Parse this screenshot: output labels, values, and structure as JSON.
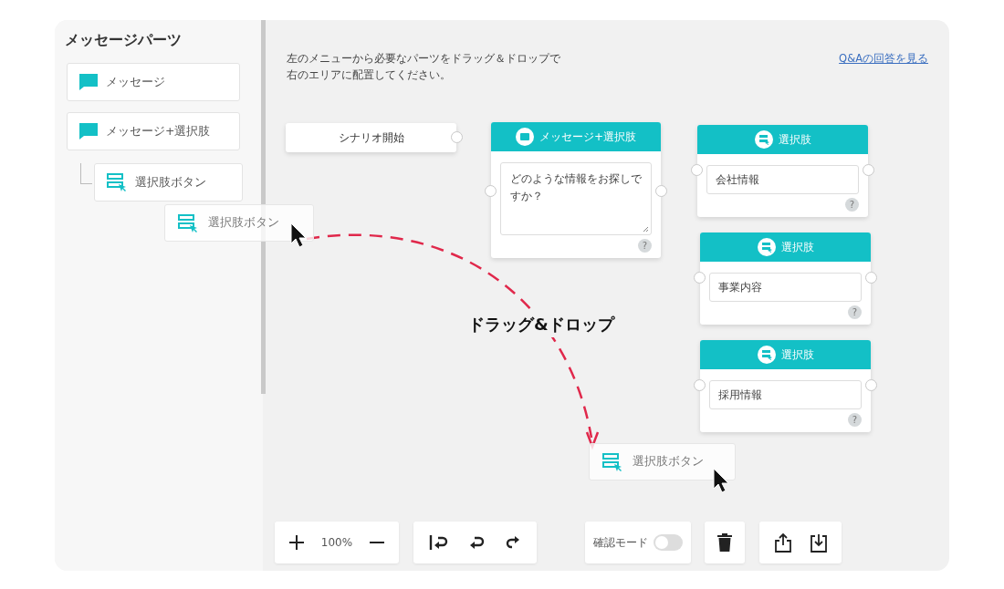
{
  "sidebar": {
    "title": "メッセージパーツ",
    "items": [
      {
        "label": "メッセージ",
        "kind": "message"
      },
      {
        "label": "メッセージ+選択肢",
        "kind": "message",
        "children": [
          {
            "label": "選択肢ボタン",
            "kind": "choice"
          }
        ]
      }
    ]
  },
  "drag_ghost": {
    "label": "選択肢ボタン"
  },
  "canvas": {
    "instructions": [
      "左のメニューから必要なパーツをドラッグ＆ドロップで",
      "右のエリアに配置してください。"
    ],
    "link": "Q&Aの回答を見る",
    "nodes": [
      {
        "kind": "start",
        "label": "シナリオ開始"
      },
      {
        "kind": "message",
        "title": "メッセージ+選択肢",
        "text": "どのような情報をお探しですか？",
        "help": "?"
      },
      {
        "kind": "choice",
        "title": "選択肢",
        "value": "会社情報",
        "help": "?"
      },
      {
        "kind": "choice",
        "title": "選択肢",
        "value": "事業内容",
        "help": "?"
      },
      {
        "kind": "choice",
        "title": "選択肢",
        "value": "採用情報",
        "help": "?"
      }
    ],
    "annotation": "ドラッグ&ドロップ",
    "drop_ghost": {
      "label": "選択肢ボタン"
    }
  },
  "toolbar": {
    "zoom": "100%",
    "mode": {
      "label": "確認モード",
      "on": false
    }
  }
}
